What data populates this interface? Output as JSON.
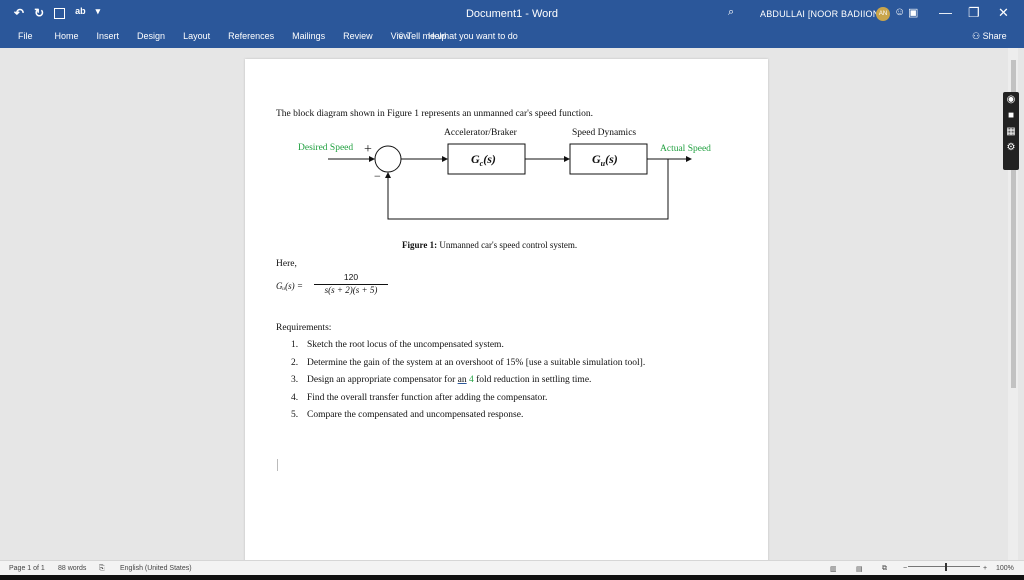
{
  "titlebar": {
    "doc_title": "Document1  -  Word",
    "user_name": "ABDULLAI [NOOR BADIION",
    "avatar_initials": "AN",
    "qat": [
      "undo-icon",
      "redo-icon",
      "save-icon",
      "spelling-icon",
      "customize-icon"
    ],
    "window_buttons": {
      "minimize": "—",
      "restore": "❐",
      "close": "✕"
    }
  },
  "ribbon": {
    "tabs": [
      "File",
      "Home",
      "Insert",
      "Design",
      "Layout",
      "References",
      "Mailings",
      "Review",
      "View",
      "Help"
    ],
    "tell_me": "Tell me what you want to do",
    "share": "Share"
  },
  "document": {
    "intro": "The block diagram shown in Figure 1 represents an unmanned car's speed function.",
    "diagram": {
      "label_accel": "Accelerator/Braker",
      "label_speed_dyn": "Speed Dynamics",
      "desired": "Desired Speed",
      "actual": "Actual Speed",
      "plus": "+",
      "minus": "−",
      "gc": "G",
      "gc_sub": "c",
      "gu": "G",
      "gu_sub": "u",
      "s_arg": "(s)"
    },
    "caption_bold": "Figure 1:",
    "caption_text": " Unmanned car's speed control system.",
    "here": "Here,",
    "equation": {
      "lhs": "Gᵤ(s) =",
      "numerator": "120",
      "denominator": "s(s + 2)(s + 5)"
    },
    "requirements_title": "Requirements:",
    "requirements": [
      {
        "num": "1.",
        "text": "Sketch the root locus of the uncompensated system."
      },
      {
        "num": "2.",
        "text": "Determine the gain of the system at an overshoot of 15% [use a suitable simulation tool]."
      },
      {
        "num": "3.",
        "pre": "Design an appropriate compensator for ",
        "u": "an",
        "mid": " ",
        "g": "4",
        "post": " fold reduction in settling time."
      },
      {
        "num": "4.",
        "text": "Find the overall transfer function after adding the compensator."
      },
      {
        "num": "5.",
        "text": "Compare the compensated and uncompensated response."
      }
    ]
  },
  "status": {
    "page": "Page 1 of 1",
    "words": "88 words",
    "language": "English (United States)",
    "zoom": "100%"
  },
  "colors": {
    "ribbon": "#2b579a",
    "green_label": "#21a040"
  }
}
